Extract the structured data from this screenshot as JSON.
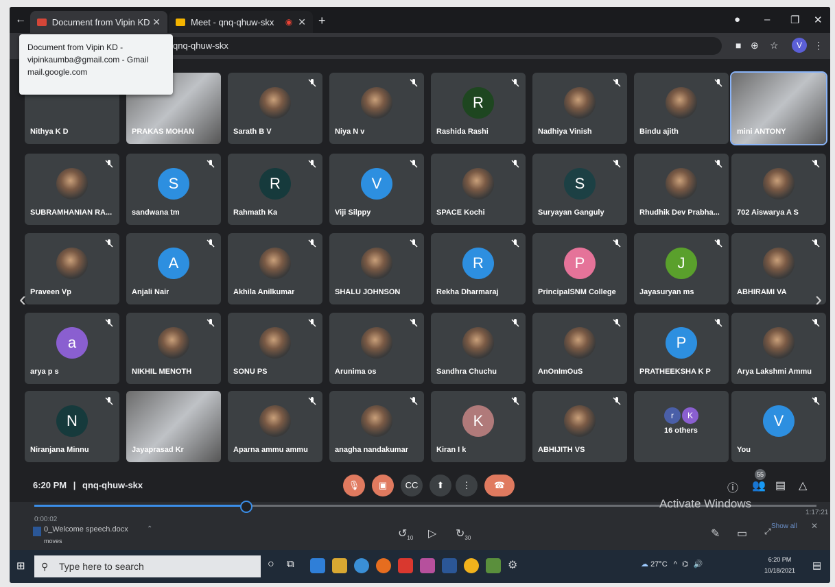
{
  "browser": {
    "tabs": [
      {
        "label": "Document from Vipin KD - vipink",
        "active": false
      },
      {
        "label": "Meet - qnq-qhuw-skx",
        "active": true
      }
    ],
    "address": "qnq-qhuw-skx",
    "profile_initial": "V"
  },
  "tooltip": {
    "line1": "Document from Vipin KD -",
    "line2": "vipinkaumba@gmail.com - Gmail",
    "line3": "mail.google.com"
  },
  "participants": [
    {
      "name": "Nithya K D",
      "type": "blank"
    },
    {
      "name": "PRAKAS MOHAN",
      "type": "video"
    },
    {
      "name": "Sarath B V",
      "type": "photo"
    },
    {
      "name": "Niya N v",
      "type": "photo"
    },
    {
      "name": "Rashida Rashi",
      "type": "initial",
      "initial": "R",
      "color": "#1e4620"
    },
    {
      "name": "Nadhiya Vinish",
      "type": "photo"
    },
    {
      "name": "Bindu ajith",
      "type": "photo"
    },
    {
      "name": "mini ANTONY",
      "type": "video"
    },
    {
      "name": "SUBRAMHANIAN RA...",
      "type": "photo"
    },
    {
      "name": "sandwana tm",
      "type": "initial",
      "initial": "S",
      "color": "#2d8fe0"
    },
    {
      "name": "Rahmath Ka",
      "type": "initial",
      "initial": "R",
      "color": "#163a3c"
    },
    {
      "name": "Viji Silppy",
      "type": "initial",
      "initial": "V",
      "color": "#2d8fe0"
    },
    {
      "name": "SPACE Kochi",
      "type": "photo"
    },
    {
      "name": "Suryayan Ganguly",
      "type": "initial",
      "initial": "S",
      "color": "#1c4044"
    },
    {
      "name": "Rhudhik Dev Prabha...",
      "type": "photo"
    },
    {
      "name": "702 Aiswarya A S",
      "type": "photo"
    },
    {
      "name": "Praveen Vp",
      "type": "photo"
    },
    {
      "name": "Anjali Nair",
      "type": "initial",
      "initial": "A",
      "color": "#2d8fe0"
    },
    {
      "name": "Akhila Anilkumar",
      "type": "photo"
    },
    {
      "name": "SHALU JOHNSON",
      "type": "photo"
    },
    {
      "name": "Rekha Dharmaraj",
      "type": "initial",
      "initial": "R",
      "color": "#2d8fe0"
    },
    {
      "name": "PrincipalSNM College",
      "type": "initial",
      "initial": "P",
      "color": "#e57399"
    },
    {
      "name": "Jayasuryan ms",
      "type": "initial",
      "initial": "J",
      "color": "#5aa02c"
    },
    {
      "name": "ABHIRAMI VA",
      "type": "photo"
    },
    {
      "name": "arya p s",
      "type": "initial",
      "initial": "a",
      "color": "#8a5fd0"
    },
    {
      "name": "NIKHIL MENOTH",
      "type": "photo"
    },
    {
      "name": "SONU PS",
      "type": "photo"
    },
    {
      "name": "Arunima os",
      "type": "photo"
    },
    {
      "name": "Sandhra Chuchu",
      "type": "photo"
    },
    {
      "name": "AnOnImOuS",
      "type": "photo"
    },
    {
      "name": "PRATHEEKSHA K P",
      "type": "initial",
      "initial": "P",
      "color": "#2d8fe0"
    },
    {
      "name": "Arya Lakshmi Ammu",
      "type": "photo"
    },
    {
      "name": "Niranjana Minnu",
      "type": "initial",
      "initial": "N",
      "color": "#163a3c"
    },
    {
      "name": "Jayaprasad Kr",
      "type": "video"
    },
    {
      "name": "Aparna ammu ammu",
      "type": "photo"
    },
    {
      "name": "anagha nandakumar",
      "type": "photo"
    },
    {
      "name": "Kiran I k",
      "type": "initial",
      "initial": "K",
      "color": "#b07a7a"
    },
    {
      "name": "ABHIJITH VS",
      "type": "photo"
    },
    {
      "name": "16 others",
      "type": "others"
    },
    {
      "name": "You",
      "type": "initial",
      "initial": "V",
      "color": "#2d8fe0"
    }
  ],
  "others_initials": [
    "r",
    "K"
  ],
  "meeting": {
    "time": "6:20 PM",
    "separator": "|",
    "code": "qnq-qhuw-skx",
    "participant_count": "55"
  },
  "watermark": "Activate Windows",
  "player": {
    "current_time": "0:00:02",
    "end_time": "1:17:21",
    "progress": 0.27,
    "file": "0_Welcome speech.docx",
    "sub": "moves",
    "show_all": "Show all",
    "skip_back": "10",
    "skip_fwd": "30"
  },
  "taskbar": {
    "search_placeholder": "Type here to search",
    "weather": "27°C",
    "time": "6:20 PM",
    "date": "10/18/2021"
  },
  "colors": {
    "meet_bg": "#202124",
    "tile_bg": "#3c4043",
    "hangup_red": "#e07a5f",
    "accent_blue": "#3b8ee8"
  }
}
